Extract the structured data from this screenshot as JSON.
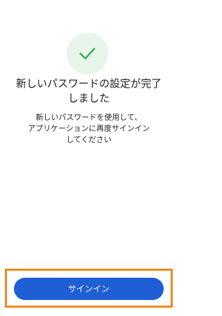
{
  "success": {
    "icon": "checkmark-icon",
    "title": "新しいパスワードの設定が完了しました",
    "message": "新しいパスワードを使用して、\nアプリケーションに再度サインイン\nしてください"
  },
  "actions": {
    "sign_in_label": "サインイン"
  },
  "colors": {
    "primary": "#1f5fd6",
    "success": "#2fae4a",
    "success_bg": "#e8f5ea",
    "highlight": "#ee8a1f"
  }
}
